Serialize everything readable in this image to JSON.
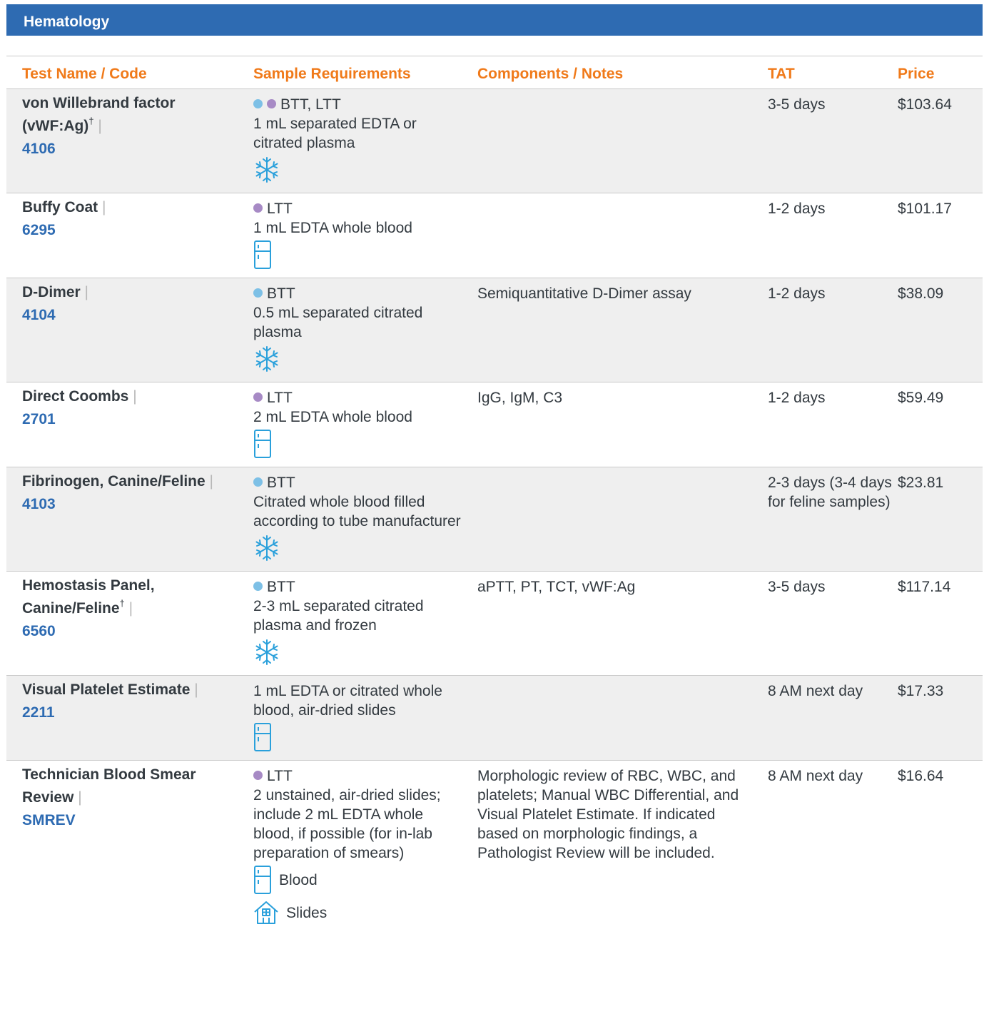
{
  "section": {
    "title": "Hematology"
  },
  "columns": [
    "Test Name / Code",
    "Sample Requirements",
    "Components / Notes",
    "TAT",
    "Price"
  ],
  "colors": {
    "header_bg": "#2e6bb2",
    "column_header": "#f07a1a",
    "code": "#2e6bb2",
    "btt_dot": "#7dc0e6",
    "ltt_dot": "#a78ac5",
    "icon": "#2aa0db"
  },
  "rows": [
    {
      "name": "von Willebrand factor (vWF:Ag)",
      "dagger": "†",
      "code": "4106",
      "tubes": "BTT, LTT",
      "dots": [
        "blue",
        "purple"
      ],
      "sample": "1 mL separated EDTA or citrated plasma",
      "storage": [
        {
          "icon": "snowflake-icon",
          "label": ""
        }
      ],
      "notes": "",
      "tat": "3-5 days",
      "price": "$103.64"
    },
    {
      "name": "Buffy Coat",
      "dagger": "",
      "code": "6295",
      "tubes": "LTT",
      "dots": [
        "purple"
      ],
      "sample": "1 mL EDTA whole blood",
      "storage": [
        {
          "icon": "refrigerator-icon",
          "label": ""
        }
      ],
      "notes": "",
      "tat": "1-2 days",
      "price": "$101.17"
    },
    {
      "name": "D-Dimer",
      "dagger": "",
      "code": "4104",
      "tubes": "BTT",
      "dots": [
        "blue"
      ],
      "sample": "0.5 mL separated citrated plasma",
      "storage": [
        {
          "icon": "snowflake-icon",
          "label": ""
        }
      ],
      "notes": "Semiquantitative D-Dimer assay",
      "tat": "1-2 days",
      "price": "$38.09"
    },
    {
      "name": "Direct Coombs",
      "dagger": "",
      "code": "2701",
      "tubes": "LTT",
      "dots": [
        "purple"
      ],
      "sample": "2 mL EDTA whole blood",
      "storage": [
        {
          "icon": "refrigerator-icon",
          "label": ""
        }
      ],
      "notes": "IgG, IgM, C3",
      "tat": "1-2 days",
      "price": "$59.49"
    },
    {
      "name": "Fibrinogen, Canine/Feline",
      "dagger": "",
      "code": "4103",
      "tubes": "BTT",
      "dots": [
        "blue"
      ],
      "sample": "Citrated whole blood filled according to tube manufacturer",
      "storage": [
        {
          "icon": "snowflake-icon",
          "label": ""
        }
      ],
      "notes": "",
      "tat": "2-3 days (3-4 days for feline samples)",
      "price": "$23.81"
    },
    {
      "name": "Hemostasis Panel, Canine/Feline",
      "dagger": "†",
      "code": "6560",
      "tubes": "BTT",
      "dots": [
        "blue"
      ],
      "sample": "2-3 mL separated citrated plasma and frozen",
      "storage": [
        {
          "icon": "snowflake-icon",
          "label": ""
        }
      ],
      "notes": "aPTT, PT, TCT, vWF:Ag",
      "tat": "3-5 days",
      "price": "$117.14"
    },
    {
      "name": "Visual Platelet Estimate",
      "dagger": "",
      "code": "2211",
      "tubes": "",
      "dots": [],
      "sample": "1 mL EDTA or citrated whole blood, air-dried slides",
      "storage": [
        {
          "icon": "refrigerator-icon",
          "label": ""
        }
      ],
      "notes": "",
      "tat": "8 AM next day",
      "price": "$17.33"
    },
    {
      "name": "Technician Blood Smear Review",
      "dagger": "",
      "code": "SMREV",
      "tubes": "LTT",
      "dots": [
        "purple"
      ],
      "sample": "2 unstained, air-dried slides; include 2 mL EDTA whole blood, if possible (for in-lab preparation of smears)",
      "storage": [
        {
          "icon": "refrigerator-icon",
          "label": "Blood"
        },
        {
          "icon": "house-icon",
          "label": "Slides"
        }
      ],
      "notes": "Morphologic review of RBC, WBC, and platelets; Manual WBC Differential, and Visual Platelet Estimate. If indicated based on morphologic findings, a Pathologist Review will be included.",
      "tat": "8 AM next day",
      "price": "$16.64"
    }
  ]
}
